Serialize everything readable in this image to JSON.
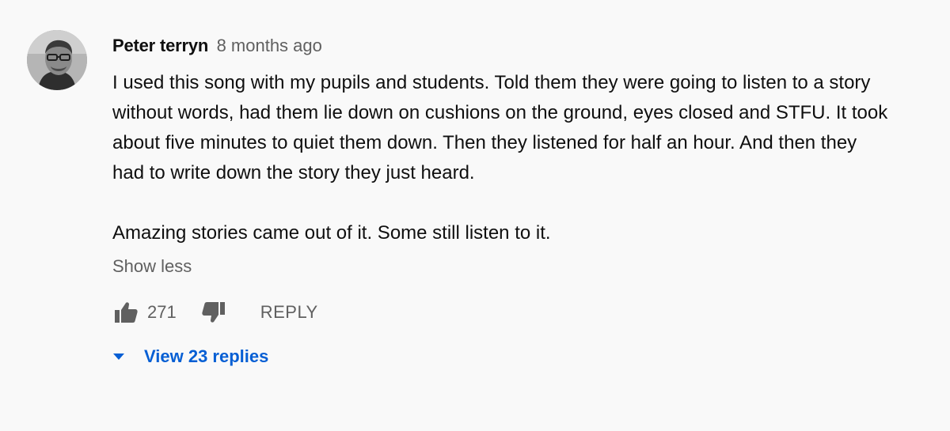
{
  "comment": {
    "author": "Peter terryn",
    "timestamp": "8 months ago",
    "avatar_icon": "user-avatar",
    "paragraphs": [
      "I used this song with my pupils and students. Told them they were going to listen to a story without words, had them lie down on cushions on the ground, eyes closed and STFU. It took about five minutes to quiet them down. Then they listened for half an hour. And then they had to write down the story they just heard.",
      "Amazing stories came out of it. Some still listen to it."
    ],
    "show_less_label": "Show less",
    "likes": "271",
    "reply_label": "REPLY",
    "view_replies_label": "View 23 replies",
    "colors": {
      "background": "#f9f9f9",
      "text": "#0f0f0f",
      "secondary": "#606060",
      "link": "#065fd4"
    },
    "icons": {
      "like": "thumbs-up-icon",
      "dislike": "thumbs-down-icon",
      "expand": "caret-down-icon"
    }
  }
}
